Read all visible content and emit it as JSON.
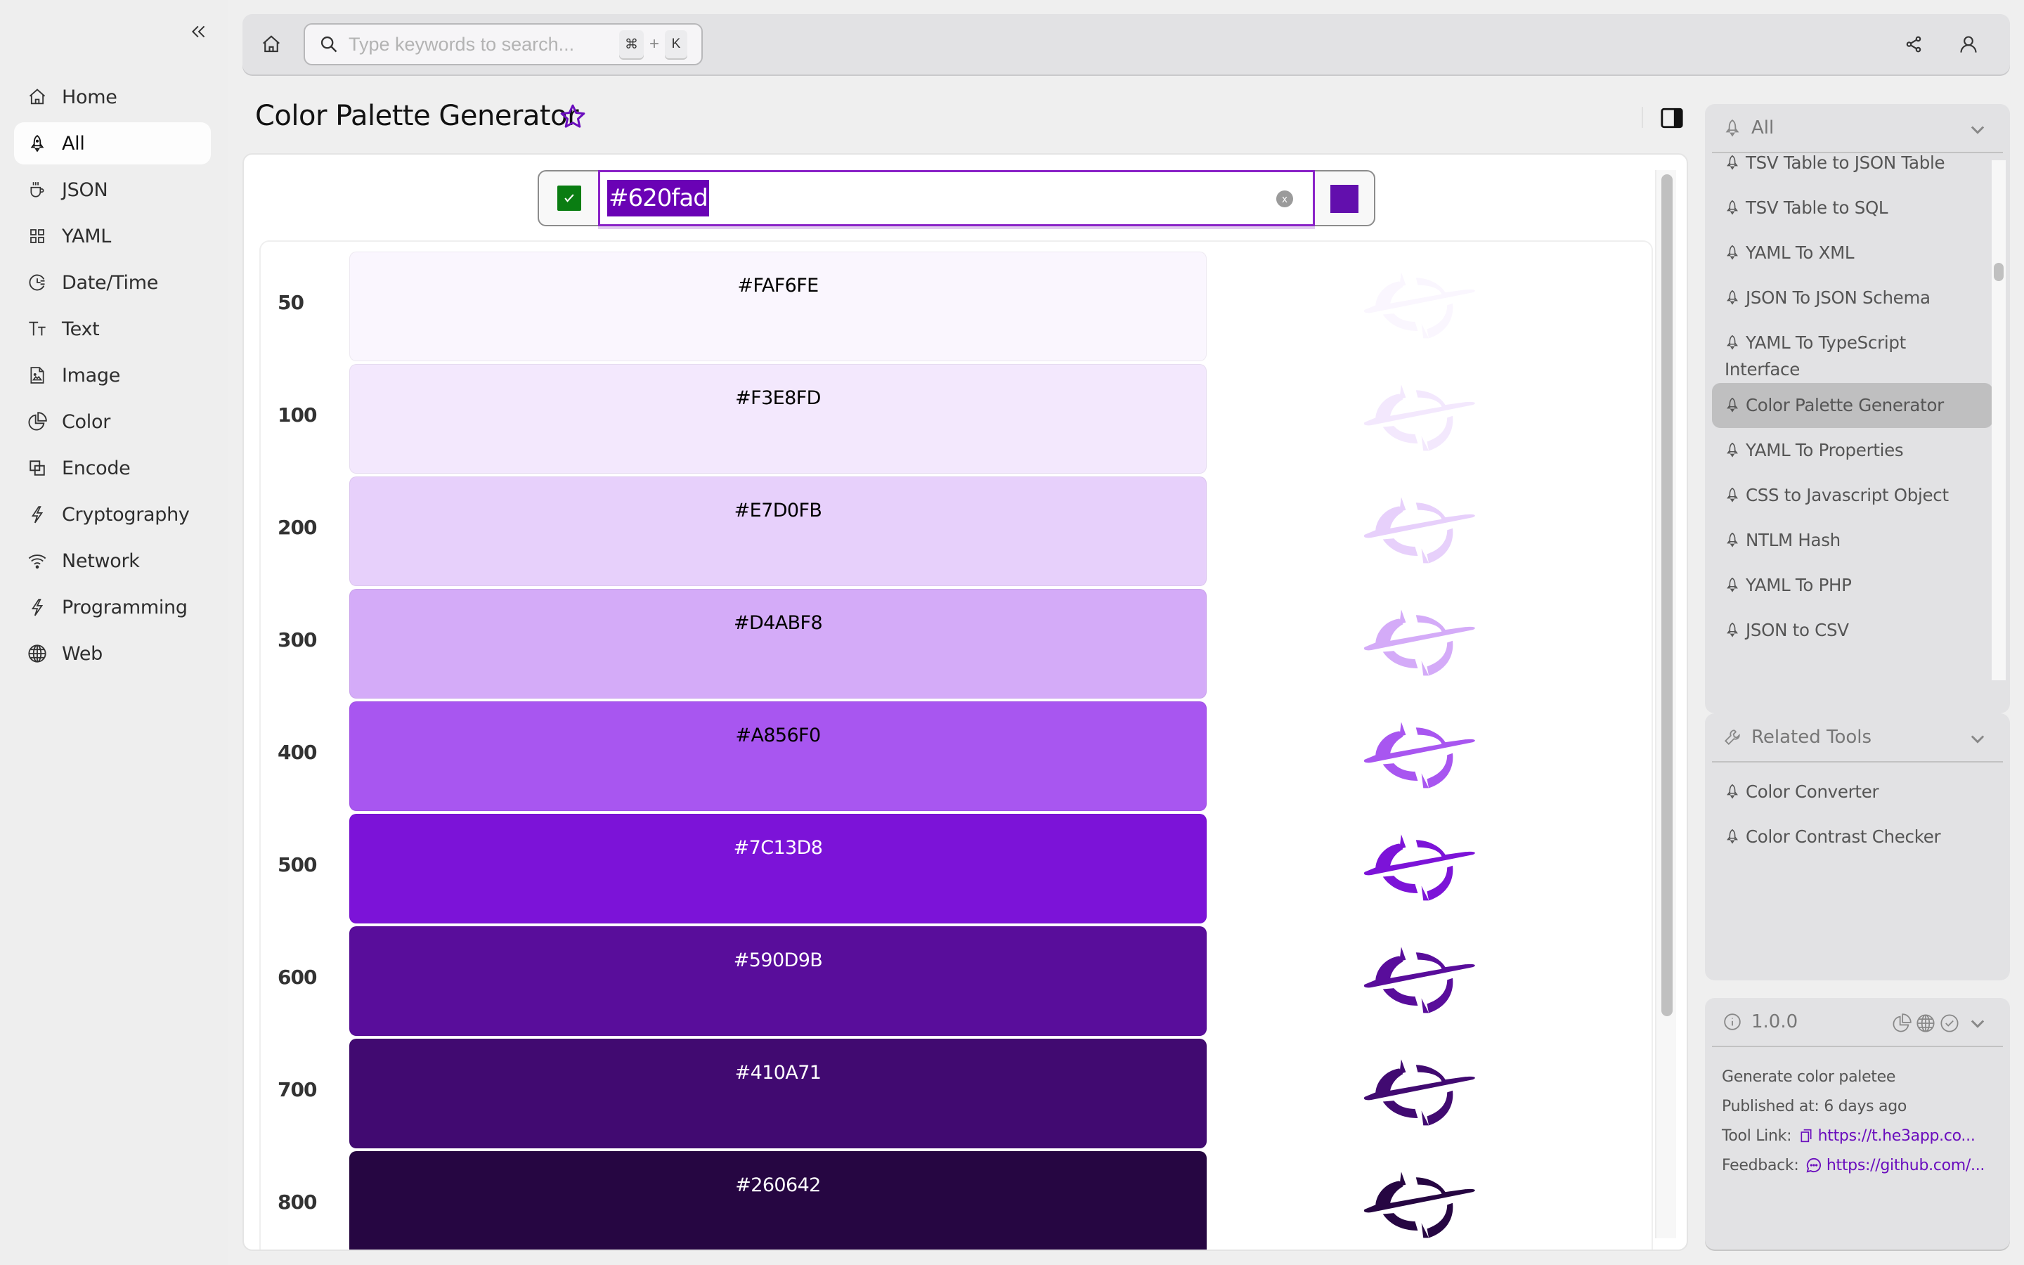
{
  "sidebar": {
    "collapse_icon": "double-chevron-left-icon",
    "items": [
      {
        "label": "Home",
        "icon": "home-icon",
        "active": false
      },
      {
        "label": "All",
        "icon": "rocket-icon",
        "active": true
      },
      {
        "label": "JSON",
        "icon": "coffee-cup-icon",
        "active": false
      },
      {
        "label": "YAML",
        "icon": "grid-icon",
        "active": false
      },
      {
        "label": "Date/Time",
        "icon": "clock-icon",
        "active": false
      },
      {
        "label": "Text",
        "icon": "text-size-icon",
        "active": false
      },
      {
        "label": "Image",
        "icon": "image-file-icon",
        "active": false
      },
      {
        "label": "Color",
        "icon": "pie-chart-icon",
        "active": false
      },
      {
        "label": "Encode",
        "icon": "overlap-squares-icon",
        "active": false
      },
      {
        "label": "Cryptography",
        "icon": "lightning-icon",
        "active": false
      },
      {
        "label": "Network",
        "icon": "wifi-icon",
        "active": false
      },
      {
        "label": "Programming",
        "icon": "lightning-icon",
        "active": false
      },
      {
        "label": "Web",
        "icon": "globe-icon",
        "active": false
      }
    ]
  },
  "topbar": {
    "search": {
      "placeholder": "Type keywords to search...",
      "value": "",
      "shortcut_key1": "⌘",
      "shortcut_plus": "+",
      "shortcut_key2": "K"
    }
  },
  "page": {
    "title": "Color Palette Generator",
    "favorite": false
  },
  "color_input": {
    "value": "#620fad",
    "valid": true,
    "preview_color": "#620fad",
    "clear_label": "x"
  },
  "palette": [
    {
      "level": "50",
      "hex": "#FAF6FE",
      "text_color": "#000000"
    },
    {
      "level": "100",
      "hex": "#F3E8FD",
      "text_color": "#000000"
    },
    {
      "level": "200",
      "hex": "#E7D0FB",
      "text_color": "#000000"
    },
    {
      "level": "300",
      "hex": "#D4ABF8",
      "text_color": "#000000"
    },
    {
      "level": "400",
      "hex": "#A856F0",
      "text_color": "#000000"
    },
    {
      "level": "500",
      "hex": "#7C13D8",
      "text_color": "#ffffff"
    },
    {
      "level": "600",
      "hex": "#590D9B",
      "text_color": "#ffffff"
    },
    {
      "level": "700",
      "hex": "#410A71",
      "text_color": "#ffffff"
    },
    {
      "level": "800",
      "hex": "#260642",
      "text_color": "#ffffff"
    }
  ],
  "right_panel": {
    "category": {
      "title": "All",
      "tools": [
        {
          "label": "TSV Table to JSON Table",
          "active": false
        },
        {
          "label": "TSV Table to SQL",
          "active": false
        },
        {
          "label": "YAML To XML",
          "active": false
        },
        {
          "label": "JSON To JSON Schema",
          "active": false
        },
        {
          "label": "YAML To TypeScript Interface",
          "active": false
        },
        {
          "label": "Color Palette Generator",
          "active": true
        },
        {
          "label": "YAML To Properties",
          "active": false
        },
        {
          "label": "CSS to Javascript Object",
          "active": false
        },
        {
          "label": "NTLM Hash",
          "active": false
        },
        {
          "label": "YAML To PHP",
          "active": false
        },
        {
          "label": "JSON to CSV",
          "active": false
        }
      ]
    },
    "related": {
      "title": "Related Tools",
      "tools": [
        {
          "label": "Color Converter"
        },
        {
          "label": "Color Contrast Checker"
        }
      ]
    },
    "info": {
      "version": "1.0.0",
      "description": "Generate color paletee",
      "published_label": "Published at: 6 days ago",
      "tool_link_label": "Tool Link:",
      "tool_link": "https://t.he3app.co...",
      "feedback_label": "Feedback:",
      "feedback_link": "https://github.com/..."
    }
  },
  "colors": {
    "accent": "#6a0dbd",
    "valid_check": "#0a7d12",
    "sidebar_bg": "#eeeeee",
    "panel_bg": "#e2e2e4"
  }
}
